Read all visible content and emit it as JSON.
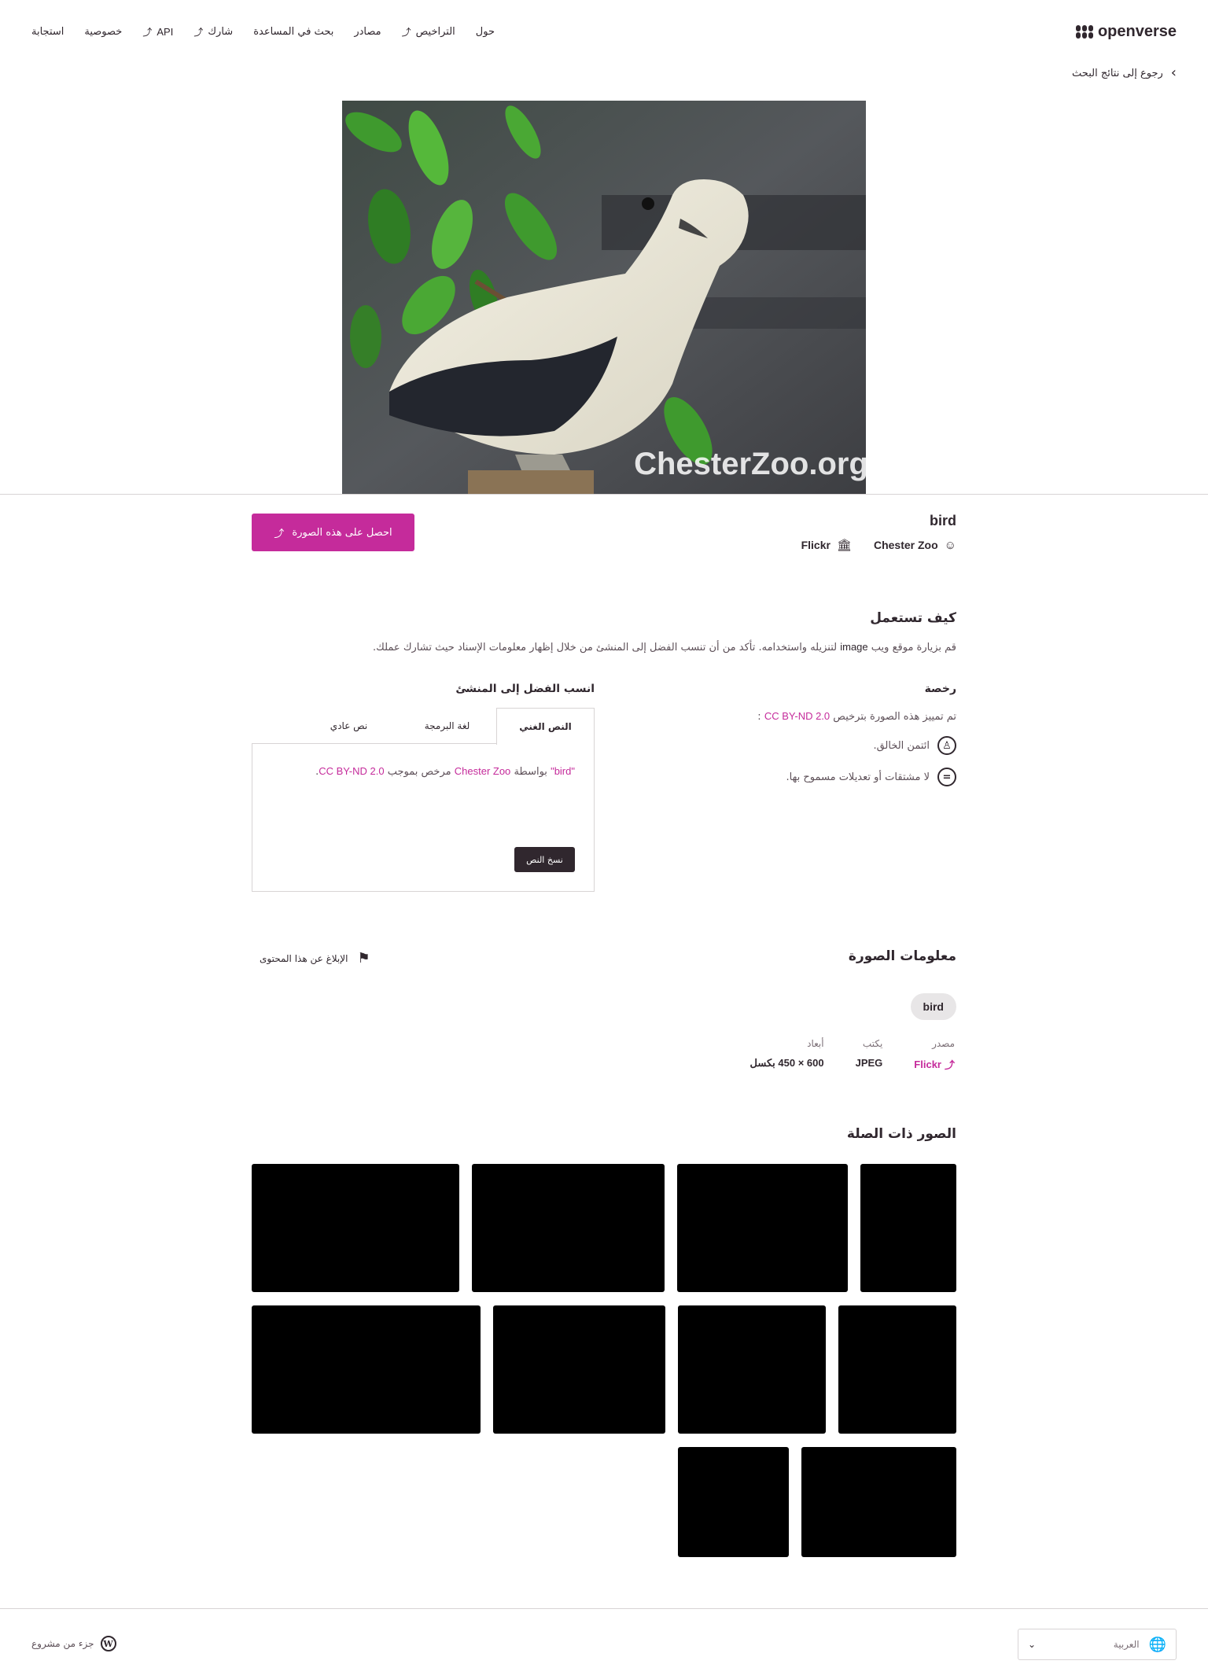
{
  "header": {
    "logo_text": "openverse",
    "nav": [
      {
        "label": "حول",
        "external": false
      },
      {
        "label": "التراخيص",
        "external": true
      },
      {
        "label": "مصادر",
        "external": false
      },
      {
        "label": "بحث في المساعدة",
        "external": false
      },
      {
        "label": "شارك",
        "external": true
      },
      {
        "label": "API",
        "external": true
      },
      {
        "label": "خصوصية",
        "external": false
      },
      {
        "label": "استجابة",
        "external": false
      }
    ]
  },
  "back_link": "رجوع إلى نتائج البحث",
  "image": {
    "watermark": "ChesterZoo.org",
    "title": "bird",
    "creator": "Chester Zoo",
    "source": "Flickr",
    "get_button": "احصل على هذه الصورة"
  },
  "how_to_use": {
    "title": "كيف تستعمل",
    "desc_before": "قم بزيارة موقع ويب",
    "desc_media": "image",
    "desc_after": "لتنزيله واستخدامه. تأكد من أن تنسب الفضل إلى المنشئ من خلال إظهار معلومات الإسناد حيث تشارك عملك."
  },
  "license": {
    "title": "رخصة",
    "line_before": "تم تمييز هذه الصورة بترخيص",
    "license_name": "CC BY-ND 2.0",
    "line_after": ":",
    "items": [
      {
        "icon": "by",
        "text": "ائتمن الخالق."
      },
      {
        "icon": "nd",
        "text": "لا مشتقات أو تعديلات مسموح بها."
      }
    ]
  },
  "attribution": {
    "title": "انسب الفضل إلى المنشئ",
    "tabs": [
      "النص الغني",
      "لغة البرمجة",
      "نص عادي"
    ],
    "active_tab": 0,
    "text_title": "\"bird\"",
    "text_by": "بواسطة",
    "text_creator": "Chester Zoo",
    "text_licensed": "مرخص بموجب",
    "text_license": "CC BY-ND 2.0",
    "text_end": ".",
    "copy_button": "نسخ النص"
  },
  "image_info": {
    "title": "معلومات الصورة",
    "report": "الإبلاغ عن هذا المحتوى",
    "tag": "bird",
    "source_label": "مصدر",
    "source_value": "Flickr",
    "type_label": "يكتب",
    "type_value": "JPEG",
    "dims_label": "أبعاد",
    "dims_value": "600 × 450 بكسل"
  },
  "related": {
    "title": "الصور ذات الصلة"
  },
  "footer": {
    "language": "العربية",
    "wp_text": "جزء من مشروع"
  },
  "colors": {
    "accent": "#c52b9b",
    "dark": "#30272e",
    "border": "#d8d4d5"
  }
}
